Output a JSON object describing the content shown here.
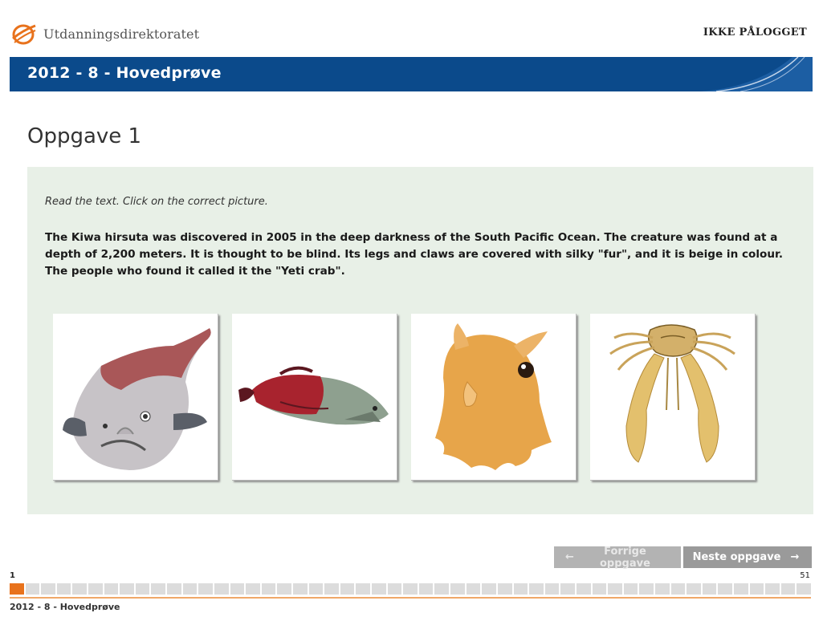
{
  "header": {
    "logo_text": "Utdanningsdirektoratet",
    "login_status": "IKKE PÅLOGGET"
  },
  "banner": {
    "title": "2012 - 8 - Hovedprøve",
    "color": "#0b4a8b"
  },
  "task": {
    "title": "Oppgave 1",
    "instruction": "Read the text. Click on the correct picture.",
    "passage": "The Kiwa hirsuta was discovered in 2005 in the deep darkness of the South Pacific Ocean. The creature was found at a depth of 2,200 meters. It is thought to be blind. Its legs and claws are covered with silky \"fur\", and it is beige in colour. The people who found it called it the \"Yeti crab\".",
    "choices": [
      {
        "icon": "blobfish-picture"
      },
      {
        "icon": "arowana-fish-picture"
      },
      {
        "icon": "dumbo-octopus-picture"
      },
      {
        "icon": "yeti-crab-picture"
      }
    ]
  },
  "navigation": {
    "prev_label": "Forrige oppgave",
    "next_label": "Neste oppgave"
  },
  "progress": {
    "current": "1",
    "total": "51",
    "total_count": 51,
    "accent_color": "#e8721c"
  },
  "footer": {
    "title": "2012 - 8 - Hovedprøve"
  }
}
